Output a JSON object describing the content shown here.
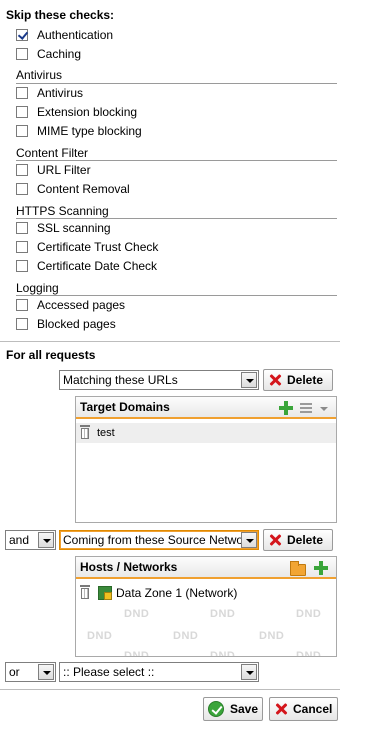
{
  "skip_checks": {
    "title": "Skip these checks:",
    "top_items": [
      {
        "label": "Authentication",
        "checked": true
      },
      {
        "label": "Caching",
        "checked": false
      }
    ],
    "groups": [
      {
        "title": "Antivirus",
        "items": [
          {
            "label": "Antivirus",
            "checked": false
          },
          {
            "label": "Extension blocking",
            "checked": false
          },
          {
            "label": "MIME type blocking",
            "checked": false
          }
        ]
      },
      {
        "title": "Content Filter",
        "items": [
          {
            "label": "URL Filter",
            "checked": false
          },
          {
            "label": "Content Removal",
            "checked": false
          }
        ]
      },
      {
        "title": "HTTPS Scanning",
        "items": [
          {
            "label": "SSL scanning",
            "checked": false
          },
          {
            "label": "Certificate Trust Check",
            "checked": false
          },
          {
            "label": "Certificate Date Check",
            "checked": false
          }
        ]
      },
      {
        "title": "Logging",
        "items": [
          {
            "label": "Accessed pages",
            "checked": false
          },
          {
            "label": "Blocked pages",
            "checked": false
          }
        ]
      }
    ]
  },
  "requests": {
    "title": "For all requests",
    "condition1": {
      "select_value": "Matching these URLs",
      "delete_label": "Delete",
      "panel_title": "Target Domains",
      "items": [
        {
          "label": "test"
        }
      ]
    },
    "condition2": {
      "connector": "and",
      "select_value": "Coming from these Source Networks",
      "delete_label": "Delete",
      "panel_title": "Hosts / Networks",
      "items": [
        {
          "label": "Data Zone 1 (Network)"
        }
      ],
      "dnd_label": "DND"
    },
    "condition3": {
      "connector": "or",
      "select_value": ":: Please select ::"
    }
  },
  "footer": {
    "save_label": "Save",
    "cancel_label": "Cancel"
  },
  "colors": {
    "accent_orange": "#f0a030",
    "add_green": "#3aa53a",
    "delete_red": "#d4151b"
  }
}
